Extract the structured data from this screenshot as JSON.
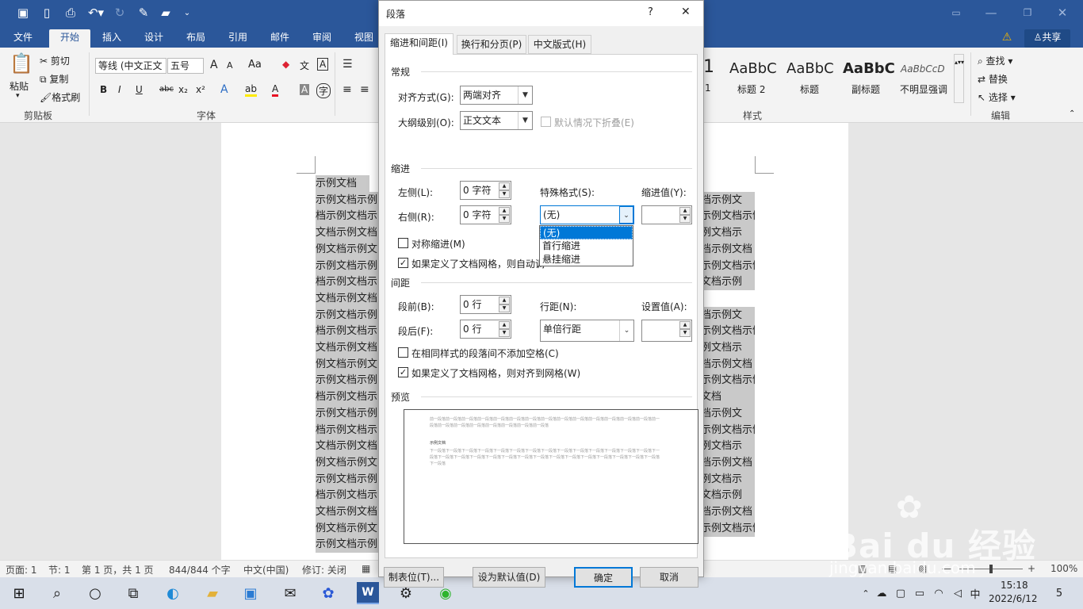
{
  "quick_access": {
    "icons": [
      "save-icon",
      "new-file-icon",
      "print-preview-icon",
      "undo-icon",
      "redo-icon",
      "edit-icon",
      "open-folder-icon",
      "customize-icon"
    ]
  },
  "ribbon_tabs": [
    "文件",
    "开始",
    "插入",
    "设计",
    "布局",
    "引用",
    "邮件",
    "审阅",
    "视图"
  ],
  "window": {
    "share": "共享"
  },
  "ribbon": {
    "paste": "粘贴",
    "cut": "剪切",
    "copy": "复制",
    "format_painter": "格式刷",
    "clipboard_group": "剪贴板",
    "font_name": "等线 (中文正文",
    "font_size": "五号",
    "font_group": "字体",
    "font_buttons": {
      "grow": "A",
      "shrink": "A",
      "case": "Aa",
      "clear": "A",
      "phonetic": "文",
      "border": "A",
      "bold": "B",
      "italic": "I",
      "underline": "U",
      "strike": "abc",
      "sub": "x₂",
      "sup": "x²",
      "effects": "A",
      "highlight": "ab",
      "color": "A",
      "shade": "A",
      "enclose": "字"
    },
    "styles": [
      {
        "sample": "1",
        "name": "1"
      },
      {
        "sample": "AaBbC",
        "name": "标题 2"
      },
      {
        "sample": "AaBbC",
        "name": "标题"
      },
      {
        "sample": "AaBbC",
        "name": "副标题"
      },
      {
        "sample": "AaBbCcD",
        "name": "不明显强调"
      }
    ],
    "styles_group": "样式",
    "find": "查找",
    "replace": "替换",
    "select": "选择",
    "editing_group": "编辑"
  },
  "document": {
    "left_lines": [
      "示例文档",
      "示例文档示例",
      "档示例文档示",
      "文档示例文档",
      "例文档示例文",
      "示例文档示例",
      "档示例文档示",
      "文档示例文档",
      "示例文档示例",
      "档示例文档示",
      "文档示例文档",
      "例文档示例文",
      "示例文档示例",
      "档示例文档示",
      "示例文档示例",
      "档示例文档示",
      "文档示例文档",
      "例文档示例文",
      "示例文档示例",
      "档示例文档示",
      "文档示例文档",
      "例文档示例文",
      "示例文档示例"
    ],
    "right_lines": [
      "",
      "档示例文",
      "示例文档示例",
      "例文档示",
      "档示例文档",
      "示例文档示例",
      "文档示例",
      "",
      "档示例文",
      "示例文档示例",
      "例文档示",
      "档示例文档",
      "示例文档示例",
      "文档",
      "档示例文",
      "示例文档示例",
      "例文档示",
      "档示例文档",
      "例文档示",
      "文档示例",
      "档示例文档",
      "示例文档示例",
      ""
    ]
  },
  "statusbar": {
    "page": "页面: 1",
    "section": "节: 1",
    "page_of": "第 1 页，共 1 页",
    "words": "844/844 个字",
    "language": "中文(中国)",
    "track": "修订: 关闭",
    "zoom": "100%"
  },
  "taskbar": {
    "time": "15:18",
    "date": "2022/6/12",
    "ime": "中",
    "notifications": "5"
  },
  "dialog": {
    "title": "段落",
    "help": "?",
    "close": "✕",
    "tabs": [
      "缩进和间距(I)",
      "换行和分页(P)",
      "中文版式(H)"
    ],
    "general": {
      "title": "常规",
      "alignment_label": "对齐方式(G):",
      "alignment_value": "两端对齐",
      "outline_label": "大纲级别(O):",
      "outline_value": "正文文本",
      "collapse_label": "默认情况下折叠(E)"
    },
    "indent": {
      "title": "缩进",
      "left_label": "左侧(L):",
      "left_value": "0 字符",
      "right_label": "右侧(R):",
      "right_value": "0 字符",
      "special_label": "特殊格式(S):",
      "special_value": "(无)",
      "by_label": "缩进值(Y):",
      "mirror_label": "对称缩进(M)",
      "grid_label": "如果定义了文档网格，则自动调",
      "special_options": [
        "(无)",
        "首行缩进",
        "悬挂缩进"
      ]
    },
    "spacing": {
      "title": "间距",
      "before_label": "段前(B):",
      "before_value": "0 行",
      "after_label": "段后(F):",
      "after_value": "0 行",
      "line_label": "行距(N):",
      "line_value": "单倍行距",
      "at_label": "设置值(A):",
      "no_space_label": "在相同样式的段落间不添加空格(C)",
      "snap_label": "如果定义了文档网格，则对齐到网格(W)"
    },
    "preview": {
      "title": "预览",
      "prev": "前一段落前一段落前一段落前一段落前一段落前一段落前一段落前一段落前一段落前一段落前一段落前一段落前一段落前一段落前一段落前一段落前一段落前一段落前一段落前一段落前一段落前一段落",
      "sample": "示例文档",
      "next": "下一段落下一段落下一段落下一段落下一段落下一段落下一段落下一段落下一段落下一段落下一段落下一段落下一段落下一段落下一段落下一段落下一段落下一段落下一段落下一段落下一段落下一段落下一段落下一段落下一段落下一段落下一段落下一段落下一段落下一段落"
    },
    "buttons": {
      "tabs": "制表位(T)...",
      "default": "设为默认值(D)",
      "ok": "确定",
      "cancel": "取消"
    }
  },
  "watermark": {
    "brand": "Bai du 经验",
    "url": "jingyan.baidu.com"
  }
}
